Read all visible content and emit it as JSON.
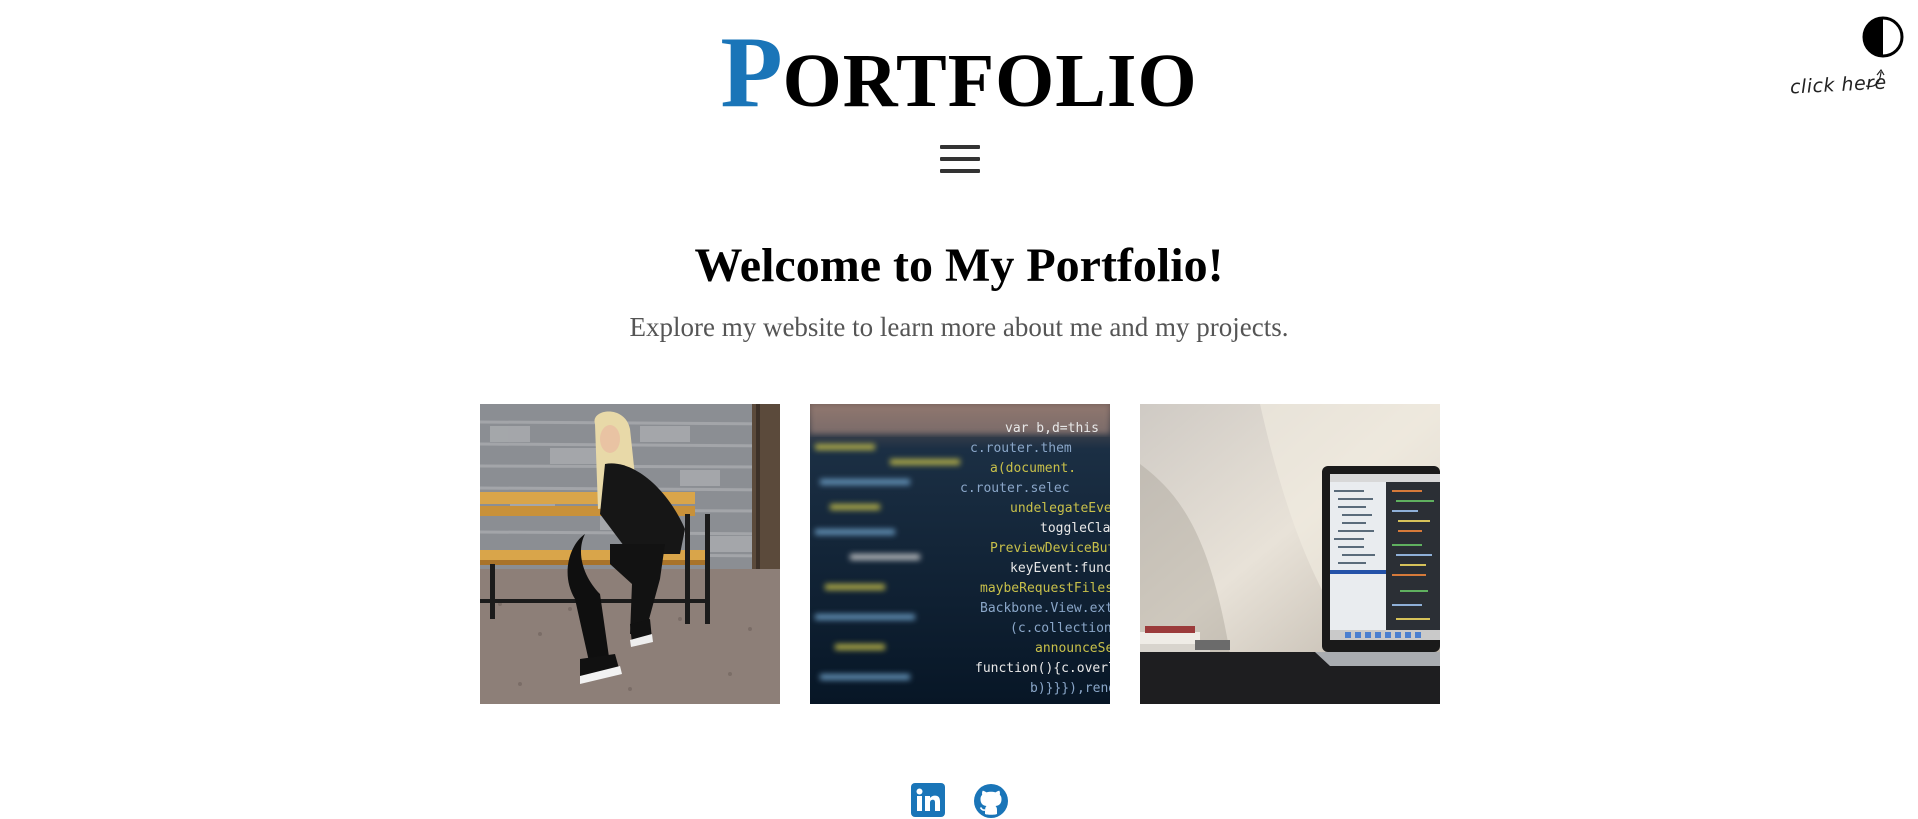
{
  "header": {
    "logo_first_letter": "P",
    "logo_rest": "ORTFOLIO",
    "logo_accent_color": "#1a75b8",
    "menu_icon": "hamburger-menu-icon"
  },
  "theme_toggle": {
    "icon": "half-circle-contrast-icon",
    "hint_text": "click here"
  },
  "hero": {
    "title": "Welcome to My Portfolio!",
    "subtitle": "Explore my website to learn more about me and my projects."
  },
  "gallery": {
    "images": [
      {
        "subject": "woman sitting on a wooden bench"
      },
      {
        "subject": "blurred code on a screen"
      },
      {
        "subject": "laptop showing code on a desk"
      }
    ]
  },
  "social": {
    "links": [
      {
        "icon": "linkedin-icon",
        "color": "#0a66c2"
      },
      {
        "icon": "github-icon",
        "color": "#1a75b8"
      }
    ]
  }
}
